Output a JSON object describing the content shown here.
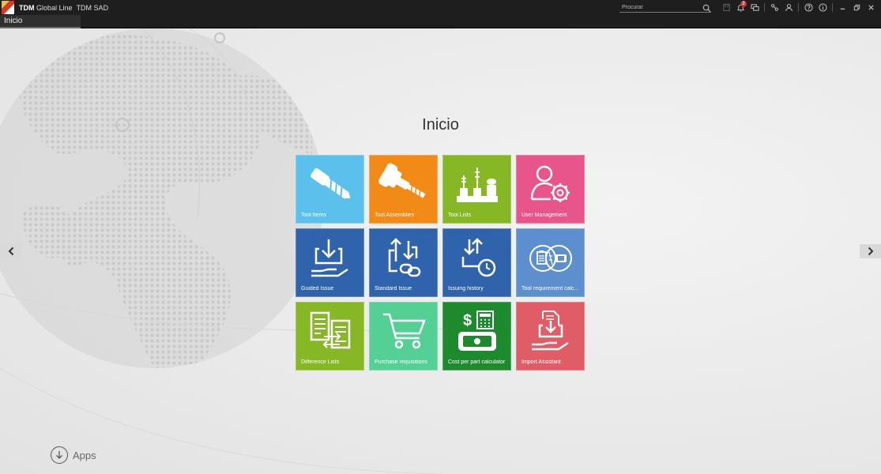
{
  "window": {
    "brand": "TDM",
    "product": " Global Line",
    "module": "TDM SAD"
  },
  "search": {
    "placeholder": "Procurar"
  },
  "notifications": {
    "count": "2"
  },
  "tabs": [
    {
      "label": "Inicio"
    }
  ],
  "page": {
    "title": "Inicio"
  },
  "tiles": [
    {
      "label": "Tool Items",
      "color": "#5bc0eb"
    },
    {
      "label": "Tool Assemblies",
      "color": "#f18a17"
    },
    {
      "label": "Tool Lists",
      "color": "#86b825"
    },
    {
      "label": "User Management",
      "color": "#e8558a"
    },
    {
      "label": "Guided Issue",
      "color": "#2f63ab"
    },
    {
      "label": "Standard Issue",
      "color": "#2f63ab"
    },
    {
      "label": "Issuing history",
      "color": "#2f63ab"
    },
    {
      "label": "Tool requirement calc...",
      "color": "#5d8fcf"
    },
    {
      "label": "Difference Lists",
      "color": "#86b825"
    },
    {
      "label": "Purchase requisitions",
      "color": "#54d095"
    },
    {
      "label": "Cost per part calculator",
      "color": "#1d8a2e"
    },
    {
      "label": "Import Assistant",
      "color": "#e05c66"
    }
  ],
  "footer": {
    "apps_label": "Apps"
  },
  "icons": {
    "search": "search-icon",
    "save": "save-icon",
    "notifications": "bell-icon",
    "messages": "chat-icon",
    "network": "network-icon",
    "user": "user-icon",
    "help": "help-icon",
    "info": "info-icon",
    "minimize": "minimize-icon",
    "restore": "restore-icon",
    "close": "close-icon"
  }
}
